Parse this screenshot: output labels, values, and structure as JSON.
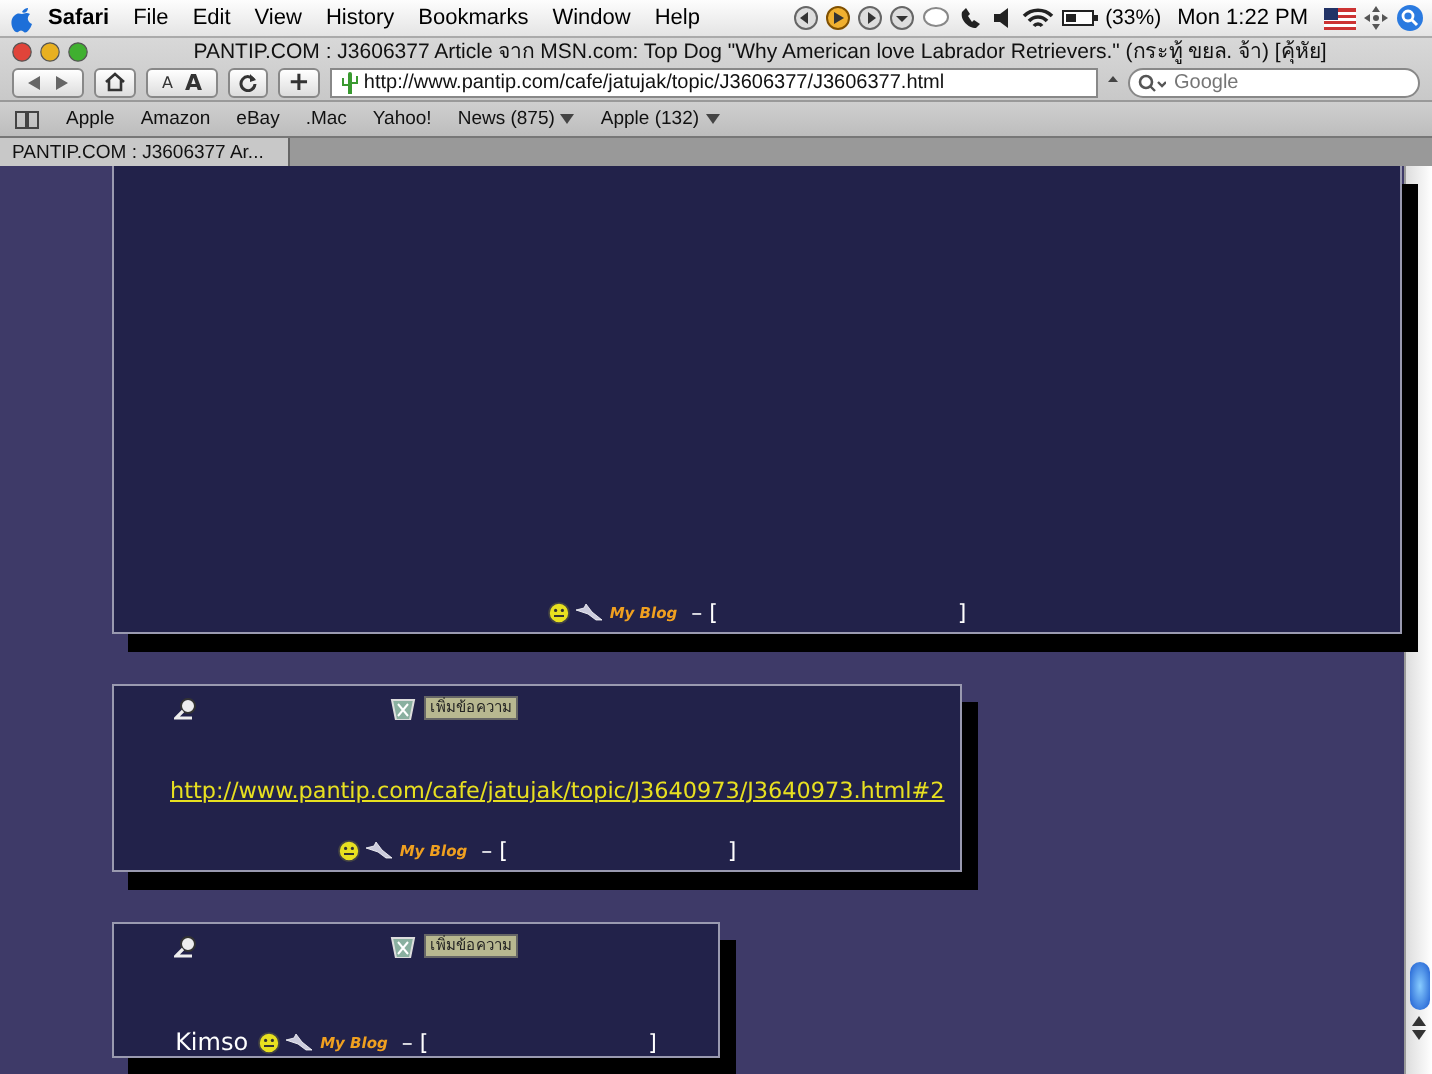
{
  "menu_bar": {
    "app": "Safari",
    "items": [
      "File",
      "Edit",
      "View",
      "History",
      "Bookmarks",
      "Window",
      "Help"
    ],
    "battery": "(33%)",
    "clock": "Mon 1:22 PM"
  },
  "window": {
    "title": "PANTIP.COM : J3606377 Article จาก MSN.com: Top Dog \"Why American love Labrador Retrievers.\" (กระทู้ ขยล. จ้า) [คุ้หัย]"
  },
  "toolbar": {
    "text_smaller": "A",
    "text_bigger": "A",
    "add": "+",
    "url": "http://www.pantip.com/cafe/jatujak/topic/J3606377/J3606377.html",
    "search": {
      "placeholder": "Google"
    }
  },
  "bookmarks": [
    {
      "label": "Apple",
      "menu": false
    },
    {
      "label": "Amazon",
      "menu": false
    },
    {
      "label": "eBay",
      "menu": false
    },
    {
      "label": ".Mac",
      "menu": false
    },
    {
      "label": "Yahoo!",
      "menu": false
    },
    {
      "label": "News (875)",
      "menu": true
    },
    {
      "label": "Apple (132)",
      "menu": true
    }
  ],
  "tab": {
    "label": "PANTIP.COM : J3606377 Ar..."
  },
  "posts": [
    {
      "footer": {
        "blog": "My Blog",
        "separator": "– [",
        "close": "]"
      }
    },
    {
      "toolbar": {
        "button": "เพิ่มข้อความ"
      },
      "link": "http://www.pantip.com/cafe/jatujak/topic/J3640973/J3640973.html#2",
      "footer": {
        "blog": "My Blog",
        "separator": "– [",
        "close": "]"
      }
    },
    {
      "toolbar": {
        "button": "เพิ่มข้อความ"
      },
      "footer": {
        "author": "Kimso",
        "blog": "My Blog",
        "separator": "– [",
        "close": "]"
      }
    }
  ]
}
